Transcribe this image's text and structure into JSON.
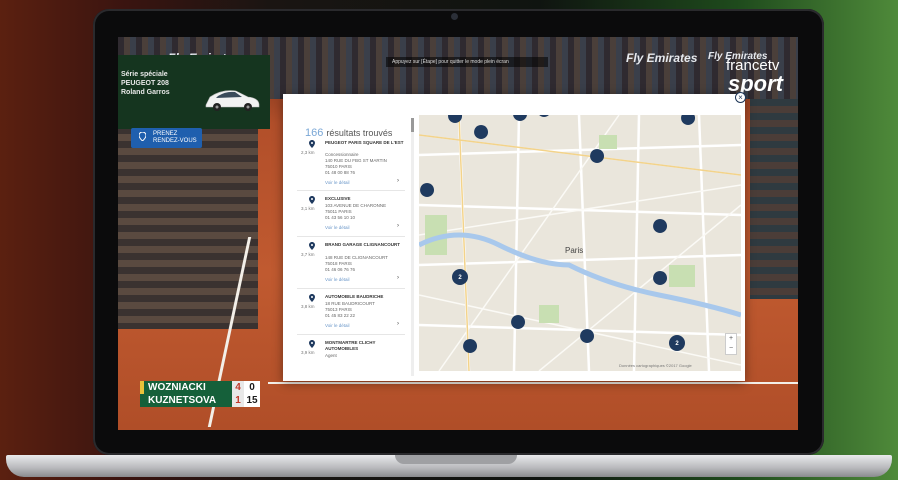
{
  "colors": {
    "accent": "#1f3a5f",
    "link": "#6b97c9",
    "score_green": "#15603a",
    "clay": "#c05a30"
  },
  "video": {
    "ad_lines": [
      "Série spéciale",
      "PEUGEOT 208",
      "Roland Garros"
    ],
    "appointment_button": [
      "PRENEZ",
      "RENDEZ-VOUS"
    ],
    "sponsors": [
      "Fly Emirates",
      "Fly Emirates",
      "Fly Emirates",
      "Fly Emirates"
    ],
    "broadcaster": {
      "name": "francetv",
      "channel": "sport"
    },
    "top_bar_text": "Appuyez sur [Étape] pour quitter le mode plein écran",
    "scoreboard": [
      {
        "player": "WOZNIACKI",
        "sets": "4",
        "points": "0",
        "serving": true
      },
      {
        "player": "KUZNETSOVA",
        "sets": "1",
        "points": "15",
        "serving": false
      }
    ]
  },
  "dialog": {
    "close_icon": "×",
    "results_count": "166",
    "results_label": "résultats trouvés",
    "items": [
      {
        "distance": "2,3 km",
        "name": "PEUGEOT PARIS SQUARE DE L'EST",
        "address": [
          "Concessionnaire",
          "140 RUE DU FBG ST MARTIN",
          "75010 PARIS",
          "01 48 00 88 76"
        ],
        "more": "Voir le détail",
        "chevron": "›"
      },
      {
        "distance": "3,1 km",
        "name": "EXCLUSIVE",
        "address": [
          "103 AVENUE DE CHARONNE",
          "75011 PARIS",
          "01 43 56 10 10"
        ],
        "more": "Voir le détail",
        "chevron": "›"
      },
      {
        "distance": "3,7 km",
        "name": "BRAND GARAGE CLIGNANCOURT",
        "address": [
          "148 RUE DE CLIGNANCOURT",
          "75018 PARIS",
          "01 46 06 76 76"
        ],
        "more": "Voir le détail",
        "chevron": "›"
      },
      {
        "distance": "3,8 km",
        "name": "AUTOMOBILE BAUDRICHE",
        "address": [
          "18 RUE BAUDRICOURT",
          "75013 PARIS",
          "01 45 83 22 22"
        ],
        "more": "Voir le détail",
        "chevron": "›"
      },
      {
        "distance": "3,9 km",
        "name": "MONTMARTRE CLICHY AUTOMOBILES",
        "address": [
          "Agent"
        ],
        "more": "",
        "chevron": ""
      }
    ],
    "map": {
      "city_label": "Paris",
      "zoom_in": "+",
      "zoom_out": "−",
      "clusters": [
        "2",
        "2"
      ],
      "footer": "Données cartographiques ©2017 Google"
    }
  }
}
